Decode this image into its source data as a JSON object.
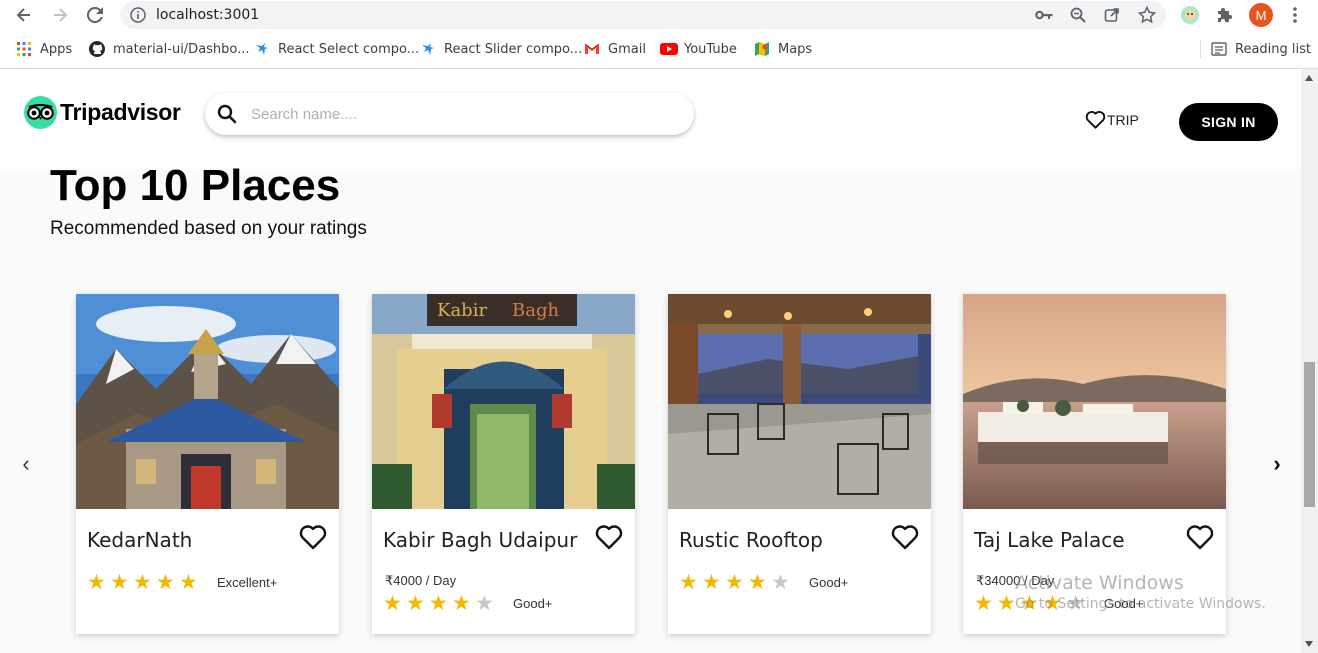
{
  "browser": {
    "url": "localhost:3001",
    "avatar_initial": "M",
    "bookmarks": [
      {
        "label": "Apps",
        "icon": "apps-grid-icon"
      },
      {
        "label": "material-ui/Dashbo...",
        "icon": "github-icon"
      },
      {
        "label": "React Select compo...",
        "icon": "react-icon"
      },
      {
        "label": "React Slider compo...",
        "icon": "react-icon"
      },
      {
        "label": "Gmail",
        "icon": "gmail-icon"
      },
      {
        "label": "YouTube",
        "icon": "youtube-icon"
      },
      {
        "label": "Maps",
        "icon": "maps-icon"
      }
    ],
    "reading_list": "Reading list"
  },
  "header": {
    "logo_text": "Tripadvisor",
    "search_placeholder": "Search name....",
    "trip_label": "TRIP",
    "signin_label": "SIGN IN"
  },
  "section": {
    "title": "Top 10 Places",
    "subtitle": "Recommended based on your ratings"
  },
  "cards": [
    {
      "name": "KedarNath",
      "price": "",
      "stars": 5,
      "rating_label": "Excellent+"
    },
    {
      "name": "Kabir Bagh Udaipur",
      "price": "₹4000 / Day",
      "stars": 4,
      "rating_label": "Good+"
    },
    {
      "name": "Rustic Rooftop",
      "price": "",
      "stars": 4,
      "rating_label": "Good+"
    },
    {
      "name": "Taj Lake Palace",
      "price": "₹34000 / Day",
      "stars": 4,
      "rating_label": "Good+"
    }
  ],
  "carousel": {
    "prev": "‹",
    "next": "›"
  },
  "watermark": {
    "title": "Activate Windows",
    "subtitle": "Go to Settings to activate Windows."
  },
  "colors": {
    "brand_green": "#34e0a1",
    "star": "#f5b700",
    "signin_bg": "#000000"
  }
}
